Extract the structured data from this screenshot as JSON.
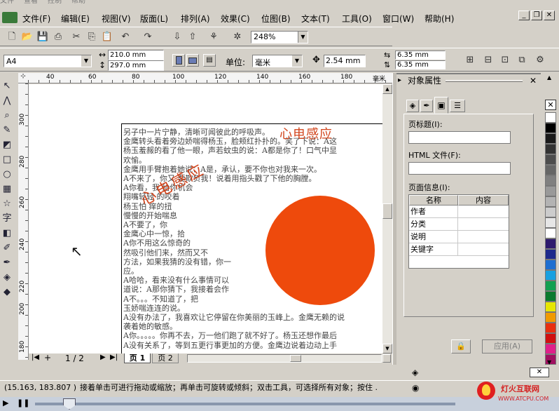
{
  "top_strip": [
    "文件",
    "查看",
    "控制",
    "帮助"
  ],
  "menu": [
    "文件(F)",
    "编辑(E)",
    "视图(V)",
    "版面(L)",
    "排列(A)",
    "效果(C)",
    "位图(B)",
    "文本(T)",
    "工具(O)",
    "窗口(W)",
    "帮助(H)"
  ],
  "toolbar": {
    "zoom": "248%"
  },
  "propbar": {
    "paper": "A4",
    "width": "210.0 mm",
    "height": "297.0 mm",
    "unit_label": "单位:",
    "unit": "毫米",
    "nudge": "2.54 mm",
    "dup_x": "6.35 mm",
    "dup_y": "6.35 mm"
  },
  "rulers": {
    "h_ticks": [
      "40",
      "60",
      "80",
      "100",
      "120",
      "140",
      "160",
      "180"
    ],
    "h_unit": "毫米",
    "v_ticks": [
      "300",
      "280",
      "260",
      "240",
      "220",
      "200",
      "180"
    ]
  },
  "page_text": {
    "title_right": "心电感应",
    "title_left": "心电感应",
    "lines": [
      "另子中一片宁静，清晰可闻彼此的呼吸声。",
      "金鹰转头看着旁边娇喘得杨玉，脸颊红扑扑的。笑了下说：A这",
      "杨玉羞赧的看了他一眼，声若蚊虫的说：A都是你了！口气中显",
      "欢愉。",
      "金鹰用手臂抱着她说：A是，承认，要不你也对我来一次。",
      "A不来了，你又          要欺负我！说着用指头戳了下他的胸膛。",
      "A你看，我                        给你机会",
      "翔嘴轻轻                         的咬着",
      "杨玉怕                           痒的扭",
      "                慢慢的开始喘息",
      "                A不要了，你",
      "              金鹰心中一惊，拾",
      "            A你不用这么惊奇的",
      "          然吸引他们来，然而又不",
      "方法，如果我猜的没有错，你一",
      "应。",
      "A哈哈，看来没有什么事情可以",
      "道说：A那你猜下，我接着会作",
      "A不。。。不知道了，把",
      "玉娇喘连连的说。",
      "A没有办法了，我喜欢让它停留在你美丽的玉峰上。金鹰无赖的说",
      "袭着她的敏感。",
      "A你。。。。。你再不去，万一他们跑了就不好了。杨玉还想作最后",
      "A没有关系了，等到五更行事更加的方便。金鹰边说着边动上手"
    ]
  },
  "page_nav": {
    "first": "|◀",
    "add": "+",
    "label": "1 / 2",
    "next": "▶",
    "last": "▶|",
    "tabs": [
      "页 1",
      "页 2"
    ]
  },
  "docker": {
    "title": "对象属性",
    "page_title_label": "页标题(I):",
    "page_title_value": "",
    "html_file_label": "HTML 文件(F):",
    "html_file_value": "",
    "page_info_label": "页面信息(I):",
    "table_headers": [
      "名称",
      "内容"
    ],
    "table_rows": [
      "作者",
      "分类",
      "说明",
      "关键字"
    ],
    "apply_button": "应用(A)"
  },
  "palette": [
    "#ffffff",
    "#000000",
    "#1a1a1a",
    "#333333",
    "#4d4d4d",
    "#666666",
    "#808080",
    "#999999",
    "#b3b3b3",
    "#cccccc",
    "#e6e6e6",
    "#ffffff",
    "#2e1a6e",
    "#1e2a8c",
    "#1e6ed0",
    "#18a0e0",
    "#12a050",
    "#0b7a2e",
    "#e6e600",
    "#f09a00",
    "#e83010",
    "#d01010",
    "#e0208a",
    "#a01060"
  ],
  "status": {
    "coords": "(15.163, 183.807 )",
    "hint": "接着单击可进行拖动或缩放；再单击可旋转或倾斜；双击工具，可选择所有对象；按住 ."
  },
  "watermark": {
    "cn": "灯火互联网",
    "url": "WWW.ATCPU.COM"
  }
}
